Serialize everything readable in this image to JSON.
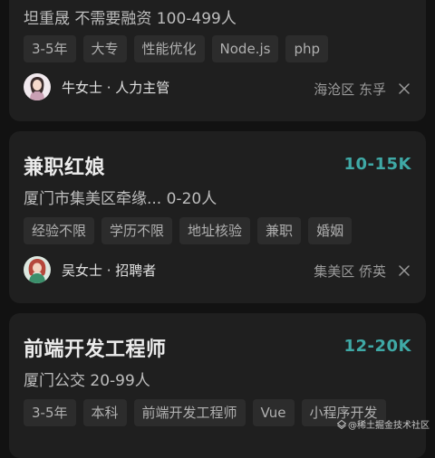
{
  "jobs": [
    {
      "title": "",
      "salary": "",
      "company": "坦重晟 不需要融资 100-499人",
      "tags": [
        "3-5年",
        "大专",
        "性能优化",
        "Node.js",
        "php"
      ],
      "recruiter": "牛女士 · 人力主管",
      "location": "海沧区 东孚"
    },
    {
      "title": "兼职红娘",
      "salary": "10-15K",
      "company": "厦门市集美区牵缘... 0-20人",
      "tags": [
        "经验不限",
        "学历不限",
        "地址核验",
        "兼职",
        "婚姻"
      ],
      "recruiter": "吴女士 · 招聘者",
      "location": "集美区 侨英"
    },
    {
      "title": "前端开发工程师",
      "salary": "12-20K",
      "company": "厦门公交 20-99人",
      "tags": [
        "3-5年",
        "本科",
        "前端开发工程师",
        "Vue",
        "小程序开发"
      ],
      "recruiter": "",
      "location": ""
    }
  ],
  "watermark": "@稀土掘金技术社区",
  "colors": {
    "salary": "#3fa9a6",
    "card": "#1f1f1f",
    "background": "#121212",
    "tag": "#2c2c2c"
  }
}
